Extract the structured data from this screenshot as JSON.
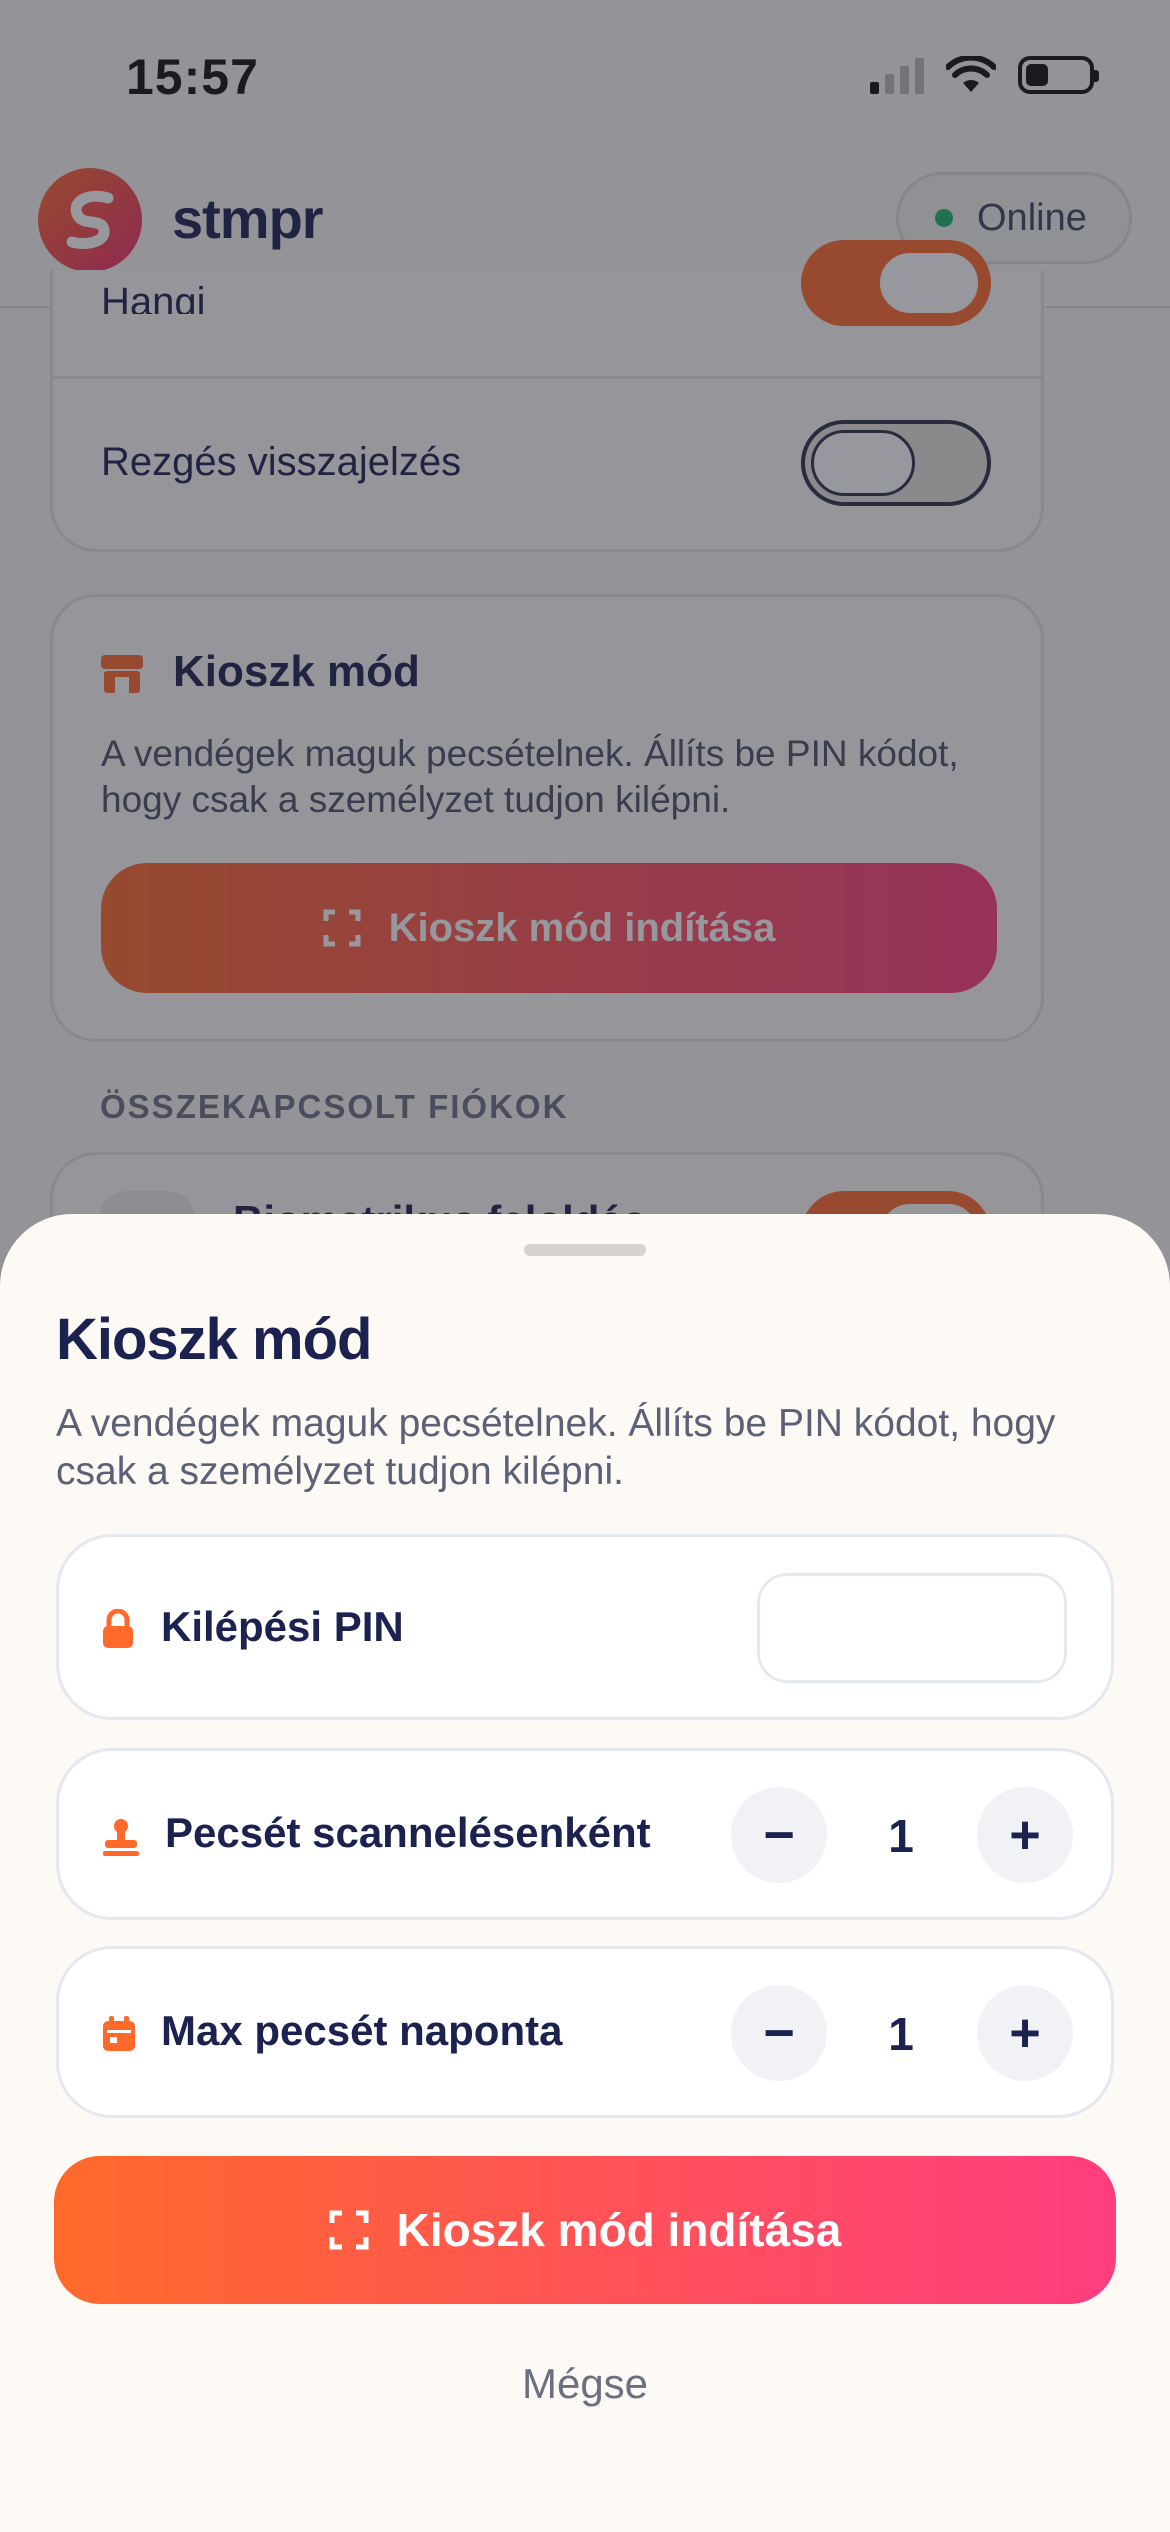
{
  "status_bar": {
    "time": "15:57"
  },
  "header": {
    "app_name": "stmpr",
    "status": "Online"
  },
  "background": {
    "toggle_row_1": {
      "label": "Hangj"
    },
    "toggle_row_2": {
      "label": "Rezgés visszajelzés"
    },
    "kiosk_card": {
      "title": "Kioszk mód",
      "description": "A vendégek maguk pecsételnek. Állíts be PIN kódot, hogy csak a személyzet tudjon kilépni.",
      "button_label": "Kioszk mód indítása"
    },
    "section_label": "ÖSSZEKAPCSOLT FIÓKOK",
    "biometric_row": {
      "label": "Biometrikus feloldás"
    }
  },
  "sheet": {
    "title": "Kioszk mód",
    "description": "A vendégek maguk pecsételnek. Állíts be PIN kódot, hogy csak a személyzet tudjon kilépni.",
    "pin": {
      "label": "Kilépési PIN",
      "value": "",
      "placeholder": ""
    },
    "stamps_per_scan": {
      "label": "Pecsét scannelésenként",
      "value": "1",
      "minus": "−",
      "plus": "+"
    },
    "max_stamps_per_day": {
      "label": "Max pecsét naponta",
      "value": "1",
      "minus": "−",
      "plus": "+"
    },
    "start_button": "Kioszk mód indítása",
    "cancel_button": "Mégse"
  },
  "colors": {
    "accent_start": "#ff6a2b",
    "accent_end": "#ff3d7f",
    "navy": "#1b2250",
    "online": "#1db36b"
  },
  "icons": [
    "signal-icon",
    "wifi-icon",
    "battery-icon",
    "logo-icon",
    "store-icon",
    "scan-icon",
    "lock-icon",
    "stamp-icon",
    "calendar-icon"
  ]
}
